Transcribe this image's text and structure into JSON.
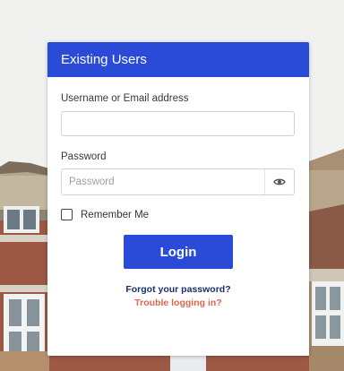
{
  "card": {
    "title": "Existing Users",
    "username_label": "Username or Email address",
    "username_value": "",
    "password_label": "Password",
    "password_placeholder": "Password",
    "remember_label": "Remember Me",
    "remember_checked": false,
    "login_label": "Login",
    "forgot_link": "Forgot your password?",
    "trouble_link": "Trouble logging in?"
  },
  "icons": {
    "password_toggle": "eye-icon"
  },
  "colors": {
    "accent": "#2a4bd8",
    "link_primary": "#1b2f6b",
    "link_warning": "#e0654f"
  }
}
